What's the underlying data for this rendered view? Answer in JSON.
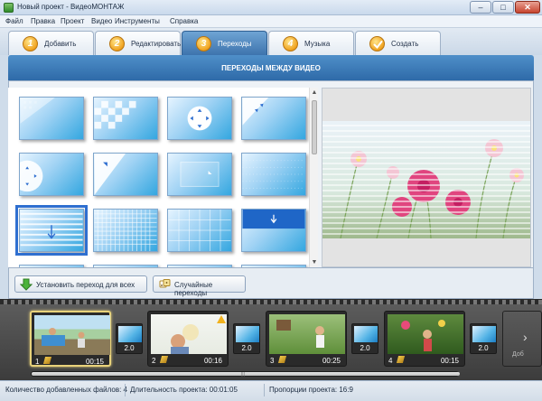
{
  "window": {
    "title": "Новый проект - ВидеоМОНТАЖ",
    "minimize": "–",
    "maximize": "□",
    "close": "✕"
  },
  "menu": [
    "Файл",
    "Правка",
    "Проект",
    "Видео",
    "Инструменты",
    "Справка"
  ],
  "tabs": [
    {
      "num": "1",
      "label": "Добавить",
      "active": false
    },
    {
      "num": "2",
      "label": "Редактировать",
      "active": false
    },
    {
      "num": "3",
      "label": "Переходы",
      "active": true
    },
    {
      "num": "4",
      "label": "Музыка",
      "active": false
    },
    {
      "num": "",
      "label": "Создать",
      "active": false,
      "icon": "check-icon"
    }
  ],
  "section": {
    "title": "ПЕРЕХОДЫ МЕЖДУ ВИДЕО"
  },
  "transitions_grid": {
    "selected_index": 8,
    "items": [
      {
        "icon": "diagonal-wipe"
      },
      {
        "icon": "checkerboard"
      },
      {
        "icon": "circle-arrows"
      },
      {
        "icon": "corner-arrows"
      },
      {
        "icon": "circle-reveal-left"
      },
      {
        "icon": "diagonal-reveal"
      },
      {
        "icon": "zoom-in"
      },
      {
        "icon": "dotted-grid"
      },
      {
        "icon": "horizontal-blinds"
      },
      {
        "icon": "fine-grid"
      },
      {
        "icon": "grid-lines"
      },
      {
        "icon": "slide-down"
      }
    ]
  },
  "actions": {
    "apply_all": "Установить переход для всех",
    "random": "Случайные переходы"
  },
  "timeline": {
    "clips": [
      {
        "num": "1",
        "duration": "00:15"
      },
      {
        "num": "2",
        "duration": "00:16"
      },
      {
        "num": "3",
        "duration": "00:25"
      },
      {
        "num": "4",
        "duration": "00:15"
      }
    ],
    "transitions": [
      {
        "duration": "2.0"
      },
      {
        "duration": "2.0"
      },
      {
        "duration": "2.0"
      },
      {
        "duration": "2.0"
      }
    ],
    "next_label": "Доб"
  },
  "status": {
    "files": "Количество добавленных файлов: 4",
    "duration": "Длительность проекта: 00:01:05",
    "aspect": "Пропорции проекта: 16:9"
  },
  "colors": {
    "accent": "#2e6aa8",
    "tab_active": "#3d73ad",
    "selection": "#2f6fd0",
    "clip_selected": "#e8d27a"
  }
}
